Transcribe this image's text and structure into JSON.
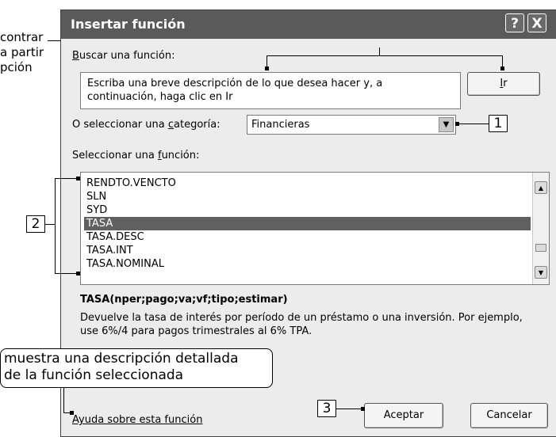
{
  "dialog": {
    "title": "Insertar función",
    "help_button": "?",
    "close_button": "X",
    "search": {
      "label_hot": "B",
      "label_rest": "uscar una función:",
      "text": "Escriba una breve descripción de lo que desea hacer y, a continuación, haga clic en Ir",
      "go_hot": "I",
      "go_rest": "r"
    },
    "category": {
      "label_pre": "O seleccionar una ",
      "label_hot": "c",
      "label_post": "ategoría:",
      "value": "Financieras"
    },
    "function_list": {
      "label_pre": "Seleccionar una ",
      "label_hot": "f",
      "label_post": "unción:",
      "items": [
        "RENDTO.VENCTO",
        "SLN",
        "SYD",
        "TASA",
        "TASA.DESC",
        "TASA.INT",
        "TASA.NOMINAL"
      ],
      "selected_index": 3
    },
    "syntax": "TASA(nper;pago;va;vf;tipo;estimar)",
    "description": "Devuelve la tasa de interés por período de un préstamo o una inversión. Por ejemplo, use 6%/4 para pagos trimestrales al 6% TPA.",
    "help_link": "Ayuda sobre esta función",
    "ok_button": "Aceptar",
    "cancel_button": "Cancelar"
  },
  "annotations": {
    "left_note": [
      "contrar",
      "a partir",
      "pción"
    ],
    "callout": [
      "muestra una descripción detallada",
      "de la función seleccionada"
    ],
    "num1": "1",
    "num2": "2",
    "num3": "3"
  }
}
